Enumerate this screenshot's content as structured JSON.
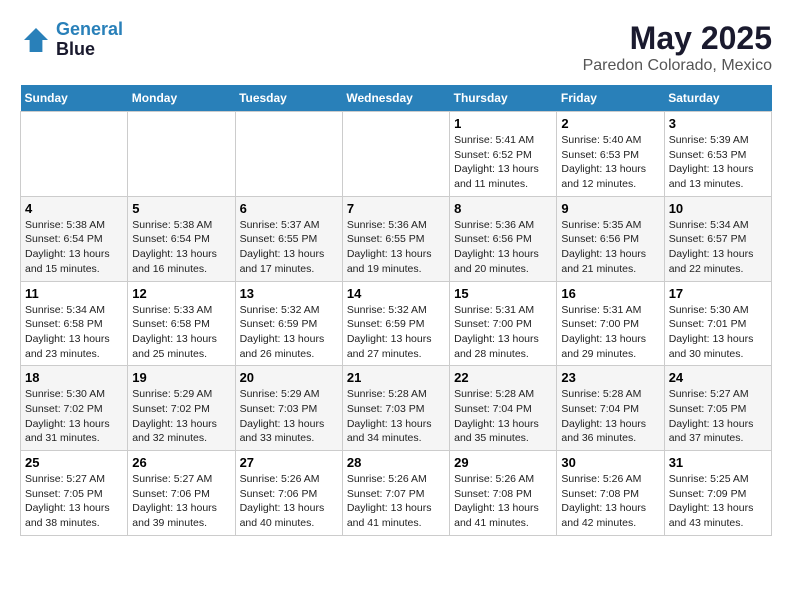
{
  "header": {
    "logo_line1": "General",
    "logo_line2": "Blue",
    "title": "May 2025",
    "subtitle": "Paredon Colorado, Mexico"
  },
  "weekdays": [
    "Sunday",
    "Monday",
    "Tuesday",
    "Wednesday",
    "Thursday",
    "Friday",
    "Saturday"
  ],
  "weeks": [
    [
      {
        "day": "",
        "content": ""
      },
      {
        "day": "",
        "content": ""
      },
      {
        "day": "",
        "content": ""
      },
      {
        "day": "",
        "content": ""
      },
      {
        "day": "1",
        "content": "Sunrise: 5:41 AM\nSunset: 6:52 PM\nDaylight: 13 hours\nand 11 minutes."
      },
      {
        "day": "2",
        "content": "Sunrise: 5:40 AM\nSunset: 6:53 PM\nDaylight: 13 hours\nand 12 minutes."
      },
      {
        "day": "3",
        "content": "Sunrise: 5:39 AM\nSunset: 6:53 PM\nDaylight: 13 hours\nand 13 minutes."
      }
    ],
    [
      {
        "day": "4",
        "content": "Sunrise: 5:38 AM\nSunset: 6:54 PM\nDaylight: 13 hours\nand 15 minutes."
      },
      {
        "day": "5",
        "content": "Sunrise: 5:38 AM\nSunset: 6:54 PM\nDaylight: 13 hours\nand 16 minutes."
      },
      {
        "day": "6",
        "content": "Sunrise: 5:37 AM\nSunset: 6:55 PM\nDaylight: 13 hours\nand 17 minutes."
      },
      {
        "day": "7",
        "content": "Sunrise: 5:36 AM\nSunset: 6:55 PM\nDaylight: 13 hours\nand 19 minutes."
      },
      {
        "day": "8",
        "content": "Sunrise: 5:36 AM\nSunset: 6:56 PM\nDaylight: 13 hours\nand 20 minutes."
      },
      {
        "day": "9",
        "content": "Sunrise: 5:35 AM\nSunset: 6:56 PM\nDaylight: 13 hours\nand 21 minutes."
      },
      {
        "day": "10",
        "content": "Sunrise: 5:34 AM\nSunset: 6:57 PM\nDaylight: 13 hours\nand 22 minutes."
      }
    ],
    [
      {
        "day": "11",
        "content": "Sunrise: 5:34 AM\nSunset: 6:58 PM\nDaylight: 13 hours\nand 23 minutes."
      },
      {
        "day": "12",
        "content": "Sunrise: 5:33 AM\nSunset: 6:58 PM\nDaylight: 13 hours\nand 25 minutes."
      },
      {
        "day": "13",
        "content": "Sunrise: 5:32 AM\nSunset: 6:59 PM\nDaylight: 13 hours\nand 26 minutes."
      },
      {
        "day": "14",
        "content": "Sunrise: 5:32 AM\nSunset: 6:59 PM\nDaylight: 13 hours\nand 27 minutes."
      },
      {
        "day": "15",
        "content": "Sunrise: 5:31 AM\nSunset: 7:00 PM\nDaylight: 13 hours\nand 28 minutes."
      },
      {
        "day": "16",
        "content": "Sunrise: 5:31 AM\nSunset: 7:00 PM\nDaylight: 13 hours\nand 29 minutes."
      },
      {
        "day": "17",
        "content": "Sunrise: 5:30 AM\nSunset: 7:01 PM\nDaylight: 13 hours\nand 30 minutes."
      }
    ],
    [
      {
        "day": "18",
        "content": "Sunrise: 5:30 AM\nSunset: 7:02 PM\nDaylight: 13 hours\nand 31 minutes."
      },
      {
        "day": "19",
        "content": "Sunrise: 5:29 AM\nSunset: 7:02 PM\nDaylight: 13 hours\nand 32 minutes."
      },
      {
        "day": "20",
        "content": "Sunrise: 5:29 AM\nSunset: 7:03 PM\nDaylight: 13 hours\nand 33 minutes."
      },
      {
        "day": "21",
        "content": "Sunrise: 5:28 AM\nSunset: 7:03 PM\nDaylight: 13 hours\nand 34 minutes."
      },
      {
        "day": "22",
        "content": "Sunrise: 5:28 AM\nSunset: 7:04 PM\nDaylight: 13 hours\nand 35 minutes."
      },
      {
        "day": "23",
        "content": "Sunrise: 5:28 AM\nSunset: 7:04 PM\nDaylight: 13 hours\nand 36 minutes."
      },
      {
        "day": "24",
        "content": "Sunrise: 5:27 AM\nSunset: 7:05 PM\nDaylight: 13 hours\nand 37 minutes."
      }
    ],
    [
      {
        "day": "25",
        "content": "Sunrise: 5:27 AM\nSunset: 7:05 PM\nDaylight: 13 hours\nand 38 minutes."
      },
      {
        "day": "26",
        "content": "Sunrise: 5:27 AM\nSunset: 7:06 PM\nDaylight: 13 hours\nand 39 minutes."
      },
      {
        "day": "27",
        "content": "Sunrise: 5:26 AM\nSunset: 7:06 PM\nDaylight: 13 hours\nand 40 minutes."
      },
      {
        "day": "28",
        "content": "Sunrise: 5:26 AM\nSunset: 7:07 PM\nDaylight: 13 hours\nand 41 minutes."
      },
      {
        "day": "29",
        "content": "Sunrise: 5:26 AM\nSunset: 7:08 PM\nDaylight: 13 hours\nand 41 minutes."
      },
      {
        "day": "30",
        "content": "Sunrise: 5:26 AM\nSunset: 7:08 PM\nDaylight: 13 hours\nand 42 minutes."
      },
      {
        "day": "31",
        "content": "Sunrise: 5:25 AM\nSunset: 7:09 PM\nDaylight: 13 hours\nand 43 minutes."
      }
    ]
  ]
}
